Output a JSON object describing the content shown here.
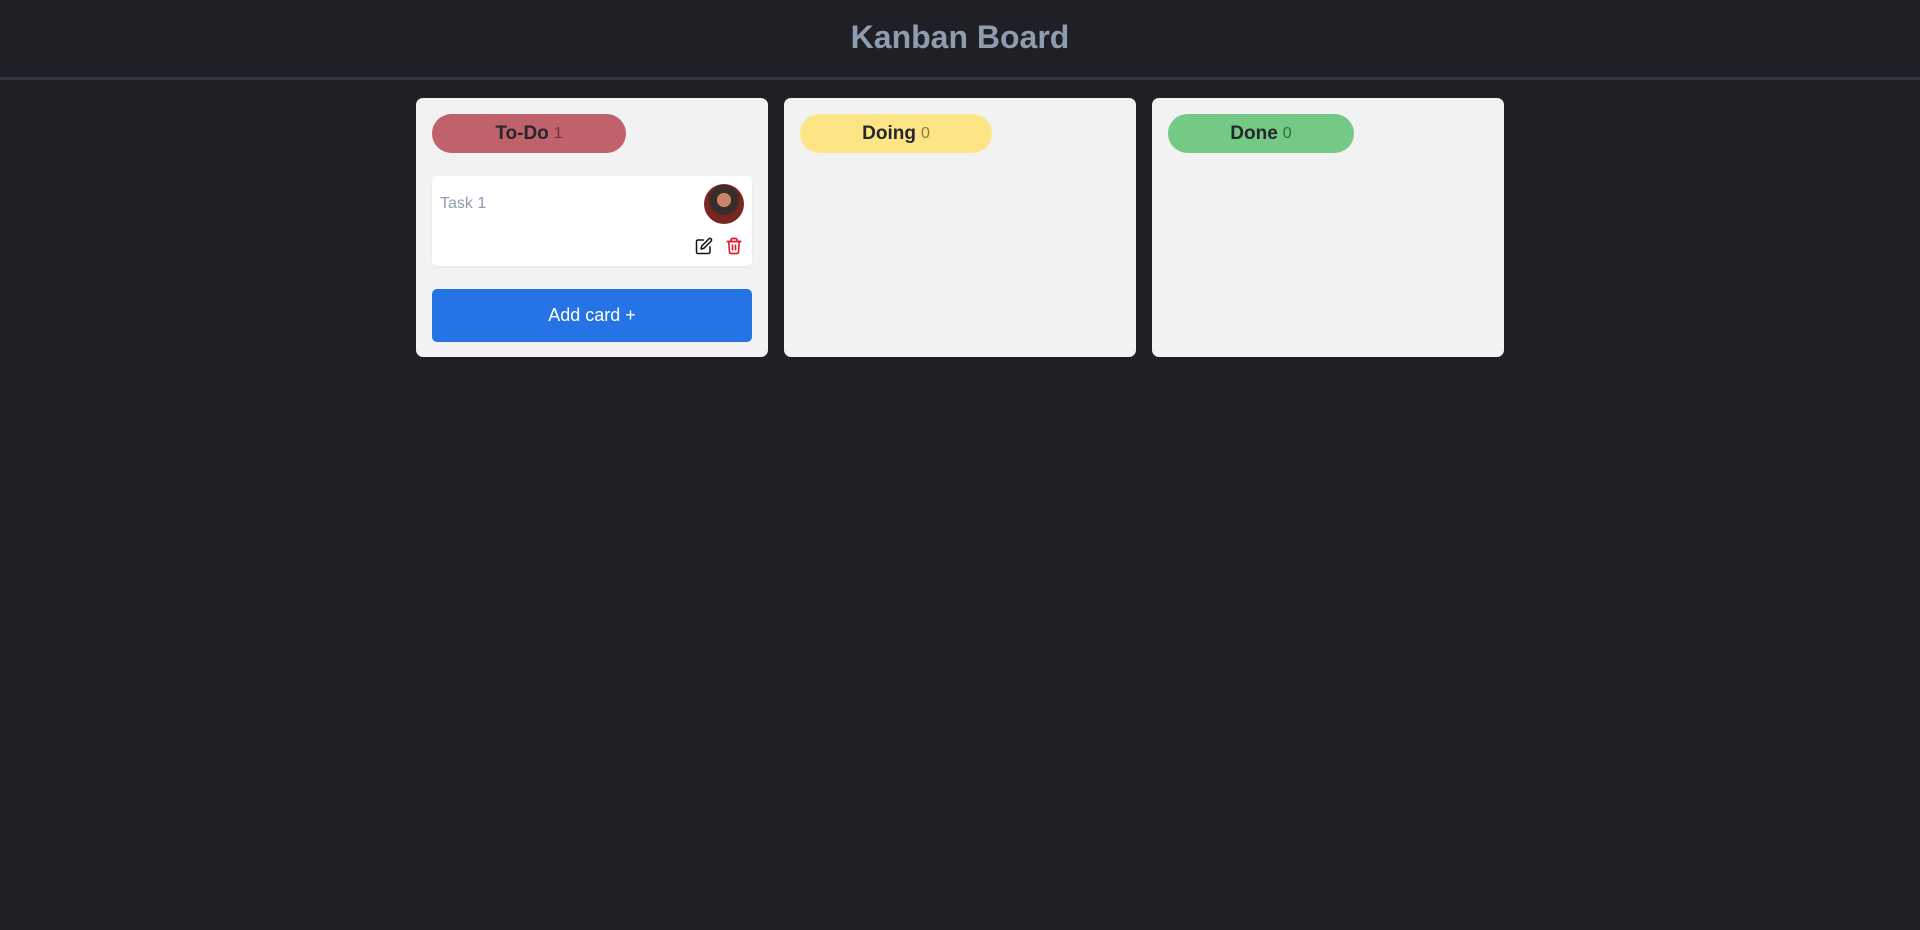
{
  "header": {
    "title": "Kanban Board"
  },
  "columns": [
    {
      "title": "To-Do",
      "count": "1",
      "color": "#c0626b",
      "cards": [
        {
          "title": "Task 1",
          "avatar": "user-avatar"
        }
      ],
      "add_label": "Add card +"
    },
    {
      "title": "Doing",
      "count": "0",
      "color": "#fde586",
      "cards": []
    },
    {
      "title": "Done",
      "count": "0",
      "color": "#74c985",
      "cards": []
    }
  ],
  "icons": {
    "edit": "edit-icon",
    "delete": "trash-icon"
  },
  "colors": {
    "background": "#1e2025",
    "column": "#f2f2f2",
    "accent": "#2673e6",
    "delete": "#e0182f"
  }
}
